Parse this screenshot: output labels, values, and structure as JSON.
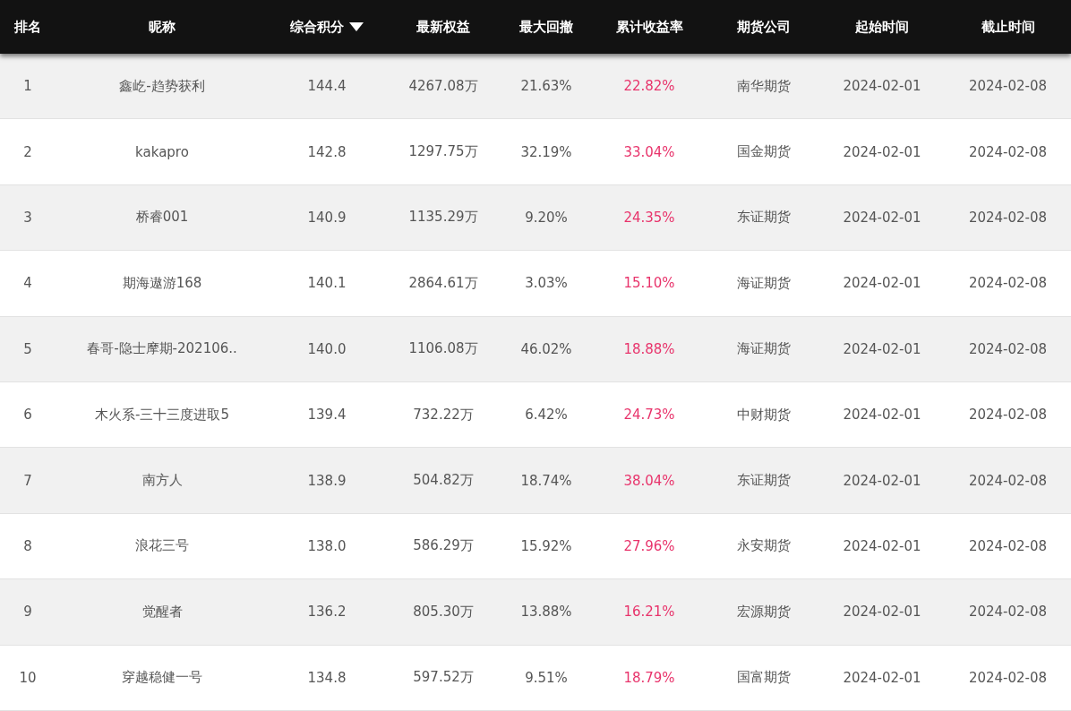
{
  "table": {
    "columns": [
      {
        "label": "排名",
        "sorted": false,
        "kind": "plain"
      },
      {
        "label": "昵称",
        "sorted": false,
        "kind": "plain"
      },
      {
        "label": "综合积分",
        "sorted": true,
        "kind": "plain"
      },
      {
        "label": "最新权益",
        "sorted": false,
        "kind": "plain"
      },
      {
        "label": "最大回撤",
        "sorted": false,
        "kind": "plain"
      },
      {
        "label": "累计收益率",
        "sorted": false,
        "kind": "gain"
      },
      {
        "label": "期货公司",
        "sorted": false,
        "kind": "plain"
      },
      {
        "label": "起始时间",
        "sorted": false,
        "kind": "plain"
      },
      {
        "label": "截止时间",
        "sorted": false,
        "kind": "plain"
      }
    ],
    "rows": [
      [
        "1",
        "鑫屹-趋势获利",
        "144.4",
        "4267.08万",
        "21.63%",
        "22.82%",
        "南华期货",
        "2024-02-01",
        "2024-02-08"
      ],
      [
        "2",
        "kakapro",
        "142.8",
        "1297.75万",
        "32.19%",
        "33.04%",
        "国金期货",
        "2024-02-01",
        "2024-02-08"
      ],
      [
        "3",
        "桥睿001",
        "140.9",
        "1135.29万",
        "9.20%",
        "24.35%",
        "东证期货",
        "2024-02-01",
        "2024-02-08"
      ],
      [
        "4",
        "期海遨游168",
        "140.1",
        "2864.61万",
        "3.03%",
        "15.10%",
        "海证期货",
        "2024-02-01",
        "2024-02-08"
      ],
      [
        "5",
        "春哥-隐士摩期-202106..",
        "140.0",
        "1106.08万",
        "46.02%",
        "18.88%",
        "海证期货",
        "2024-02-01",
        "2024-02-08"
      ],
      [
        "6",
        "木火系-三十三度进取5",
        "139.4",
        "732.22万",
        "6.42%",
        "24.73%",
        "中财期货",
        "2024-02-01",
        "2024-02-08"
      ],
      [
        "7",
        "南方人",
        "138.9",
        "504.82万",
        "18.74%",
        "38.04%",
        "东证期货",
        "2024-02-01",
        "2024-02-08"
      ],
      [
        "8",
        "浪花三号",
        "138.0",
        "586.29万",
        "15.92%",
        "27.96%",
        "永安期货",
        "2024-02-01",
        "2024-02-08"
      ],
      [
        "9",
        "觉醒者",
        "136.2",
        "805.30万",
        "13.88%",
        "16.21%",
        "宏源期货",
        "2024-02-01",
        "2024-02-08"
      ],
      [
        "10",
        "穿越稳健一号",
        "134.8",
        "597.52万",
        "9.51%",
        "18.79%",
        "国富期货",
        "2024-02-01",
        "2024-02-08"
      ]
    ]
  }
}
